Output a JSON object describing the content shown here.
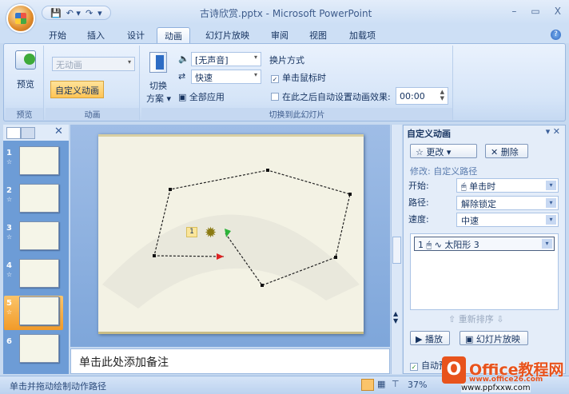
{
  "window": {
    "title": "古诗欣赏.pptx - Microsoft PowerPoint",
    "min": "–",
    "max": "▭",
    "close": "X"
  },
  "qat": {
    "save": "💾",
    "undo": "↶ ▾",
    "redo": "↷",
    "customize": "▾"
  },
  "tabs": [
    "开始",
    "插入",
    "设计",
    "动画",
    "幻灯片放映",
    "审阅",
    "视图",
    "加载项"
  ],
  "help": "?",
  "ribbon": {
    "preview": {
      "button": "预览",
      "group": "预览"
    },
    "animation": {
      "dropdown": "无动画",
      "custom": "自定义动画",
      "group": "动画"
    },
    "transition": {
      "scheme_line1": "切换",
      "scheme_line2": "方案",
      "sound": "[无声音]",
      "speed": "快速",
      "apply_all": "全部应用",
      "advance_title": "换片方式",
      "on_click": "单击鼠标时",
      "on_click_checked": true,
      "auto_after": "在此之后自动设置动画效果:",
      "time": "00:00",
      "group": "切换到此幻灯片"
    }
  },
  "slides": [
    {
      "num": "1"
    },
    {
      "num": "2"
    },
    {
      "num": "3"
    },
    {
      "num": "4"
    },
    {
      "num": "5",
      "selected": true
    },
    {
      "num": "6"
    }
  ],
  "slide": {
    "anim_tag": "1"
  },
  "notes": "单击此处添加备注",
  "taskpane": {
    "title": "自定义动画",
    "change": "更改",
    "remove": "删除",
    "modify": "修改: 自定义路径",
    "start_label": "开始:",
    "start": "单击时",
    "path_label": "路径:",
    "path": "解除锁定",
    "speed_label": "速度:",
    "speed": "中速",
    "items": [
      {
        "order": "1",
        "name": "太阳形 3"
      }
    ],
    "reorder": "重新排序",
    "play": "播放",
    "slideshow": "幻灯片放映",
    "autopreview": "自动预览",
    "autopreview_checked": true
  },
  "status": {
    "text": "单击并拖动绘制动作路径",
    "zoom": "37%"
  },
  "watermark": {
    "brand": "Office教程网",
    "url1": "www.office26.com",
    "url2": "www.ppfxxw.com"
  }
}
